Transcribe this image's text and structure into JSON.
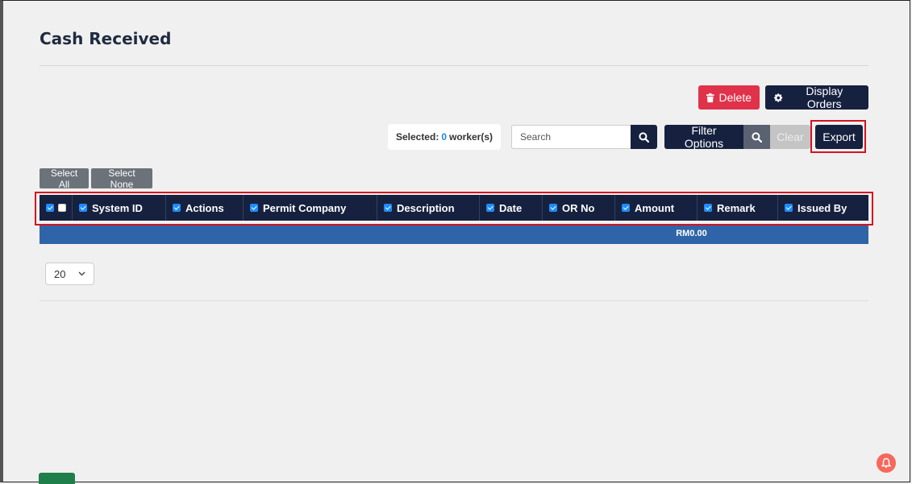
{
  "page": {
    "title": "Cash Received"
  },
  "toolbar": {
    "delete_label": "Delete",
    "display_orders_label": "Display Orders",
    "selected_prefix": "Selected:",
    "selected_count": "0",
    "selected_suffix": "worker(s)",
    "search_placeholder": "Search",
    "filter_options_label": "Filter Options",
    "clear_label": "Clear",
    "export_label": "Export",
    "select_all_label": "Select All",
    "select_none_label": "Select None"
  },
  "table": {
    "columns": [
      {
        "label": "System ID",
        "checked": true
      },
      {
        "label": "Actions",
        "checked": true
      },
      {
        "label": "Permit Company",
        "checked": true
      },
      {
        "label": "Description",
        "checked": true
      },
      {
        "label": "Date",
        "checked": true
      },
      {
        "label": "OR No",
        "checked": true
      },
      {
        "label": "Amount",
        "checked": true
      },
      {
        "label": "Remark",
        "checked": true
      },
      {
        "label": "Issued By",
        "checked": true
      }
    ],
    "total_amount": "RM0.00"
  },
  "pagination": {
    "page_size": "20"
  },
  "colors": {
    "navy": "#16213f",
    "danger": "#e0324a",
    "highlight_border": "#d6121f",
    "total_row": "#2f65a8",
    "accent_count": "#1e88e5",
    "success": "#1e7f4a",
    "notification": "#f7685c"
  },
  "icons": {
    "delete": "trash-icon",
    "display_orders": "gear-icon",
    "search": "search-icon",
    "filter_search": "search-icon",
    "page_size": "chevron-down-icon",
    "notification": "bell-icon"
  }
}
